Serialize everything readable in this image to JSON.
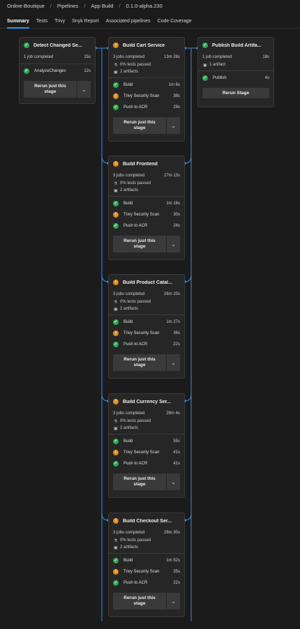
{
  "breadcrumb": [
    "Online-Boutique",
    "Pipelines",
    "App Build",
    "0.1.0-alpha.230"
  ],
  "tabs": [
    {
      "label": "Summary",
      "active": true
    },
    {
      "label": "Tests",
      "active": false
    },
    {
      "label": "Trivy",
      "active": false
    },
    {
      "label": "Snyk Report",
      "active": false
    },
    {
      "label": "Associated pipelines",
      "active": false
    },
    {
      "label": "Code Coverage",
      "active": false
    }
  ],
  "stages": {
    "detect": {
      "title": "Detect Changed Se...",
      "status": "success",
      "jobs_completed": "1 job completed",
      "duration": "15s",
      "jobs": [
        {
          "name": "AnalyzeChanges",
          "time": "12s",
          "status": "success"
        }
      ],
      "rerun_label_1": "Rerun just this",
      "rerun_label_2": "stage"
    },
    "cart": {
      "title": "Build Cart Service",
      "status": "warning",
      "jobs_completed": "3 jobs completed",
      "duration": "13m 26s",
      "tests": "0% tests passed",
      "artifacts": "2 artifacts",
      "jobs": [
        {
          "name": "Build",
          "time": "1m 6s",
          "status": "success"
        },
        {
          "name": "Trivy Security Scan",
          "time": "38s",
          "status": "warning"
        },
        {
          "name": "Push to ACR",
          "time": "29s",
          "status": "success"
        }
      ],
      "rerun_label_1": "Rerun just this",
      "rerun_label_2": "stage"
    },
    "publish": {
      "title": "Publish Build Artifa...",
      "status": "success",
      "jobs_completed": "1 job completed",
      "duration": "18s",
      "artifacts": "1 artifact",
      "jobs": [
        {
          "name": "Publish",
          "time": "4s",
          "status": "success"
        }
      ],
      "rerun_label": "Rerun Stage"
    },
    "frontend": {
      "title": "Build Frontend",
      "status": "warning",
      "jobs_completed": "3 jobs completed",
      "duration": "27m 13s",
      "tests": "0% tests passed",
      "artifacts": "2 artifacts",
      "jobs": [
        {
          "name": "Build",
          "time": "1m 16s",
          "status": "success"
        },
        {
          "name": "Trivy Security Scan",
          "time": "30s",
          "status": "warning"
        },
        {
          "name": "Push to ACR",
          "time": "24s",
          "status": "success"
        }
      ],
      "rerun_label_1": "Rerun just this",
      "rerun_label_2": "stage"
    },
    "catalog": {
      "title": "Build Product Catal...",
      "status": "warning",
      "jobs_completed": "3 jobs completed",
      "duration": "26m 20s",
      "tests": "0% tests passed",
      "artifacts": "2 artifacts",
      "jobs": [
        {
          "name": "Build",
          "time": "1m 27s",
          "status": "success"
        },
        {
          "name": "Trivy Security Scan",
          "time": "36s",
          "status": "warning"
        },
        {
          "name": "Push to ACR",
          "time": "22s",
          "status": "success"
        }
      ],
      "rerun_label_1": "Rerun just this",
      "rerun_label_2": "stage"
    },
    "currency": {
      "title": "Build Currency Ser...",
      "status": "warning",
      "jobs_completed": "3 jobs completed",
      "duration": "29m 4s",
      "tests": "0% tests passed",
      "artifacts": "2 artifacts",
      "jobs": [
        {
          "name": "Build",
          "time": "55s",
          "status": "success"
        },
        {
          "name": "Trivy Security Scan",
          "time": "41s",
          "status": "warning"
        },
        {
          "name": "Push to ACR",
          "time": "41s",
          "status": "success"
        }
      ],
      "rerun_label_1": "Rerun just this",
      "rerun_label_2": "stage"
    },
    "checkout": {
      "title": "Build Checkout Ser...",
      "status": "warning",
      "jobs_completed": "3 jobs completed",
      "duration": "28m 30s",
      "tests": "0% tests passed",
      "artifacts": "2 artifacts",
      "jobs": [
        {
          "name": "Build",
          "time": "1m 52s",
          "status": "success"
        },
        {
          "name": "Trivy Security Scan",
          "time": "35s",
          "status": "warning"
        },
        {
          "name": "Push to ACR",
          "time": "22s",
          "status": "success"
        }
      ],
      "rerun_label_1": "Rerun just this",
      "rerun_label_2": "stage"
    }
  },
  "colors": {
    "success": "#2fa84f",
    "warning": "#e08a1e",
    "connector": "#3b8fdb",
    "accent": "#3b8fdb"
  },
  "icons": {
    "success": "check-circle-icon",
    "warning": "warning-circle-icon",
    "tests": "beaker-icon",
    "artifacts": "artifact-box-icon",
    "more": "chevron-down-icon"
  }
}
